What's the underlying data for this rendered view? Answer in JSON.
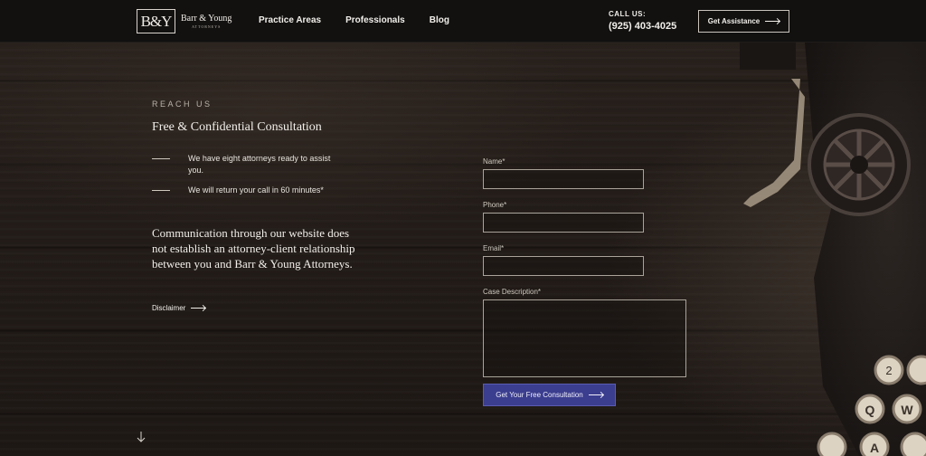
{
  "header": {
    "logo_mark": "B&Y",
    "logo_name": "Barr & Young",
    "logo_sub": "ATTORNEYS",
    "nav": [
      "Practice Areas",
      "Professionals",
      "Blog"
    ],
    "call_label": "CALL US:",
    "call_number": "(925) 403-4025",
    "assist_button": "Get Assistance"
  },
  "contact": {
    "eyebrow": "REACH US",
    "title": "Free & Confidential Consultation",
    "bullets": [
      "We have eight attorneys ready to assist you.",
      "We will return your call in 60 minutes*"
    ],
    "notice": "Communication through our website does not establish an attorney-client relationship between you and Barr & Young Attorneys.",
    "disclaimer_link": "Disclaimer"
  },
  "form": {
    "name_label": "Name*",
    "name_value": "",
    "phone_label": "Phone*",
    "phone_value": "",
    "email_label": "Email*",
    "email_value": "",
    "case_label": "Case Description*",
    "case_value": "",
    "submit_label": "Get Your Free Consultation"
  },
  "keys": {
    "row1": [
      "2"
    ],
    "row2": [
      "Q",
      "W"
    ],
    "row3": [
      "A"
    ]
  },
  "colors": {
    "header_bg": "#121110",
    "submit_bg": "#3b3d8f",
    "wood_bg": "#241d19"
  }
}
